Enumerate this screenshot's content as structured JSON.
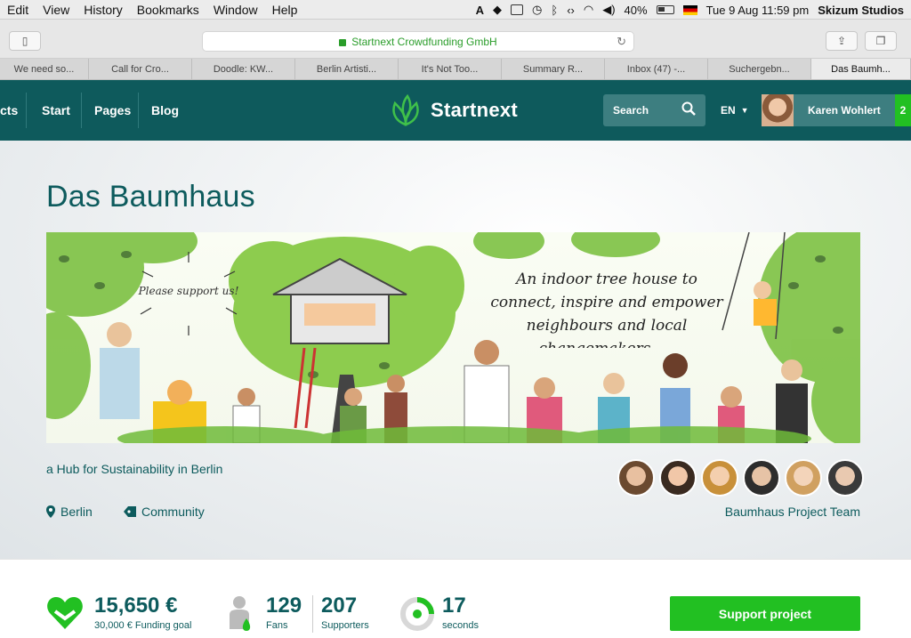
{
  "menubar": {
    "items": [
      "Edit",
      "View",
      "History",
      "Bookmarks",
      "Window",
      "Help"
    ],
    "battery": "40%",
    "datetime": "Tue 9 Aug  11:59 pm",
    "account": "Skizum Studios"
  },
  "browser": {
    "url_text": "Startnext Crowdfunding GmbH",
    "tabs": [
      "We need so...",
      "Call for Cro...",
      "Doodle: KW...",
      "Berlin Artisti...",
      "It's Not Too...",
      "Summary R...",
      "Inbox (47) -...",
      "Suchergebn...",
      "Das Baumh..."
    ],
    "active_tab_index": 8
  },
  "site_nav": {
    "links": [
      "cts",
      "Start",
      "Pages",
      "Blog"
    ],
    "logo_text": "Startnext",
    "search_label": "Search",
    "language": "EN",
    "user_name": "Karen Wohlert",
    "notification_count": "2"
  },
  "project": {
    "title": "Das Baumhaus",
    "banner_text": "An indoor tree house to connect, inspire and empower neighbours and local changemakers. . .",
    "sign_text": "Please support us!",
    "tagline": "a Hub for Sustainability in Berlin",
    "location": "Berlin",
    "category": "Community",
    "team_label": "Baumhaus Project Team"
  },
  "stats": {
    "funded_amount": "15,650 €",
    "funding_goal_label": "30,000 € Funding goal",
    "fans_count": "129",
    "fans_label": "Fans",
    "supporters_count": "207",
    "supporters_label": "Supporters",
    "time_count": "17",
    "time_label": "seconds",
    "support_button": "Support project"
  },
  "colors": {
    "brand_teal": "#0e5a5c",
    "brand_green": "#22c022",
    "text_teal": "#0d5b5d"
  }
}
